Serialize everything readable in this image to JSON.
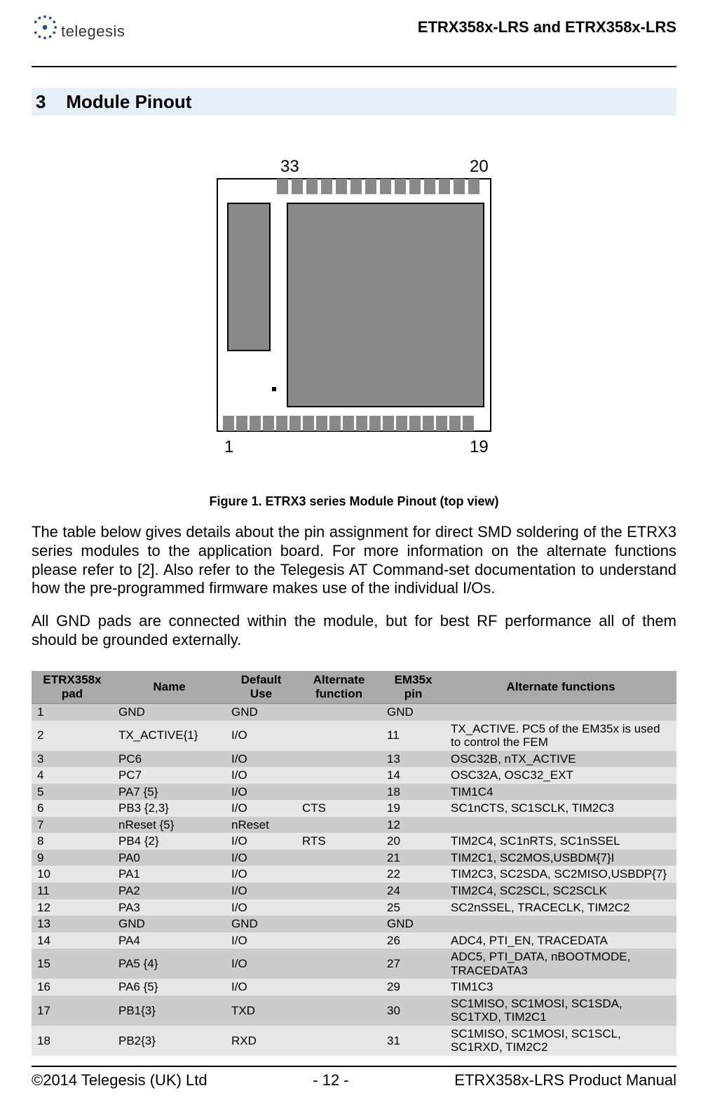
{
  "header": {
    "company": "telegesis",
    "doc_right": "ETRX358x-LRS and ETRX358x-LRS"
  },
  "section": {
    "number": "3",
    "title": "Module Pinout"
  },
  "figure": {
    "labels": {
      "tl": "33",
      "tr": "20",
      "bl": "1",
      "br": "19"
    },
    "caption": "Figure 1.  ETRX3 series Module Pinout (top view)"
  },
  "paragraphs": {
    "p1": "The table below gives details about the pin assignment for direct SMD soldering of the ETRX3 series modules to the application board. For more information on the alternate functions please refer to [2]. Also refer to the Telegesis AT Command-set documentation to understand how the pre-programmed firmware makes use of the individual I/Os.",
    "p2": "All GND pads are connected within the module, but for best RF performance all of them should be grounded externally."
  },
  "table": {
    "headers": {
      "pad": "ETRX358x pad",
      "name": "Name",
      "def": "Default Use",
      "alt1": "Alternate function",
      "em": "EM35x pin",
      "alt2": "Alternate functions"
    },
    "rows": [
      {
        "pad": "1",
        "name": "GND",
        "def": "GND",
        "alt1": "",
        "em": "GND",
        "alt2": ""
      },
      {
        "pad": "2",
        "name": "TX_ACTIVE{1}",
        "def": "I/O",
        "alt1": "",
        "em": "11",
        "alt2": "TX_ACTIVE.  PC5 of the EM35x is used to control the FEM"
      },
      {
        "pad": "3",
        "name": "PC6",
        "def": "I/O",
        "alt1": "",
        "em": "13",
        "alt2": "OSC32B, nTX_ACTIVE"
      },
      {
        "pad": "4",
        "name": "PC7",
        "def": "I/O",
        "alt1": "",
        "em": "14",
        "alt2": "OSC32A, OSC32_EXT"
      },
      {
        "pad": "5",
        "name": "PA7 {5}",
        "def": "I/O",
        "alt1": "",
        "em": "18",
        "alt2": "TIM1C4"
      },
      {
        "pad": "6",
        "name": "PB3 {2,3}",
        "def": "I/O",
        "alt1": "CTS",
        "em": "19",
        "alt2": "SC1nCTS, SC1SCLK, TIM2C3"
      },
      {
        "pad": "7",
        "name": "nReset {5}",
        "def": "nReset",
        "alt1": "",
        "em": "12",
        "alt2": ""
      },
      {
        "pad": "8",
        "name": "PB4 {2}",
        "def": "I/O",
        "alt1": "RTS",
        "em": "20",
        "alt2": "TIM2C4, SC1nRTS, SC1nSSEL"
      },
      {
        "pad": "9",
        "name": "PA0",
        "def": "I/O",
        "alt1": "",
        "em": "21",
        "alt2": "TIM2C1, SC2MOS,USBDM{7}I"
      },
      {
        "pad": "10",
        "name": "PA1",
        "def": "I/O",
        "alt1": "",
        "em": "22",
        "alt2": "TIM2C3, SC2SDA, SC2MISO,USBDP{7}"
      },
      {
        "pad": "11",
        "name": "PA2",
        "def": "I/O",
        "alt1": "",
        "em": "24",
        "alt2": "TIM2C4, SC2SCL, SC2SCLK"
      },
      {
        "pad": "12",
        "name": "PA3",
        "def": "I/O",
        "alt1": "",
        "em": "25",
        "alt2": "SC2nSSEL, TRACECLK, TIM2C2"
      },
      {
        "pad": "13",
        "name": "GND",
        "def": "GND",
        "alt1": "",
        "em": "GND",
        "alt2": ""
      },
      {
        "pad": "14",
        "name": "PA4",
        "def": "I/O",
        "alt1": "",
        "em": "26",
        "alt2": "ADC4, PTI_EN, TRACEDATA"
      },
      {
        "pad": "15",
        "name": "PA5 {4}",
        "def": "I/O",
        "alt1": "",
        "em": "27",
        "alt2": "ADC5, PTI_DATA, nBOOTMODE, TRACEDATA3"
      },
      {
        "pad": "16",
        "name": "PA6 {5}",
        "def": "I/O",
        "alt1": "",
        "em": "29",
        "alt2": "TIM1C3"
      },
      {
        "pad": "17",
        "name": "PB1{3}",
        "def": "TXD",
        "alt1": "",
        "em": "30",
        "alt2": "SC1MISO, SC1MOSI, SC1SDA, SC1TXD, TIM2C1"
      },
      {
        "pad": "18",
        "name": "PB2{3}",
        "def": "RXD",
        "alt1": "",
        "em": "31",
        "alt2": "SC1MISO, SC1MOSI, SC1SCL, SC1RXD, TIM2C2"
      }
    ]
  },
  "footer": {
    "left": "©2014 Telegesis (UK) Ltd",
    "center": "- 12 -",
    "right": "ETRX358x-LRS Product Manual"
  }
}
